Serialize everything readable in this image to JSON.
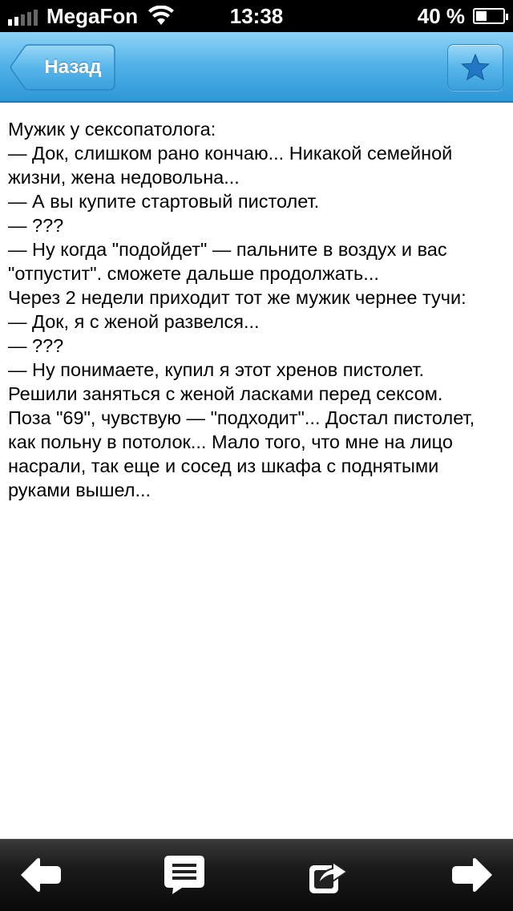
{
  "status_bar": {
    "carrier": "MegaFon",
    "time": "13:38",
    "battery_text": "40 %",
    "battery_level": 0.4,
    "signal_bars": 2
  },
  "nav": {
    "back_label": "Назад",
    "favorite_icon": "star-icon"
  },
  "content": {
    "lines": [
      "Мужик у сексопатолога:",
      "— Док, слишком рано кончаю... Никакой семейной",
      "жизни, жена недовольна...",
      "— А вы купите стартовый пистолет.",
      "— ???",
      "— Ну когда \"подойдет\" — пальните в воздух и вас",
      "\"отпустит\". сможете дальше продолжать...",
      "Через 2 недели приходит тот же мужик чернее тучи:",
      "— Док, я с женой развелся...",
      "— ???",
      "— Ну понимаете, купил я этот хренов пистолет.",
      "Решили заняться с женой ласками перед сексом.",
      "Поза \"69\", чувствую — \"подходит\"... Достал пистолет,",
      "как польну в потолок... Мало того, что мне на лицо",
      "насрали, так еще и сосед из шкафа с поднятыми",
      "руками вышел..."
    ]
  },
  "toolbar": {
    "icons": [
      "arrow-left-icon",
      "comments-icon",
      "share-icon",
      "arrow-right-icon"
    ]
  },
  "colors": {
    "nav_top": "#8fd3f7",
    "nav_bottom": "#2e97d6",
    "star": "#2277c4",
    "toolbar": "#1a1a1a"
  }
}
